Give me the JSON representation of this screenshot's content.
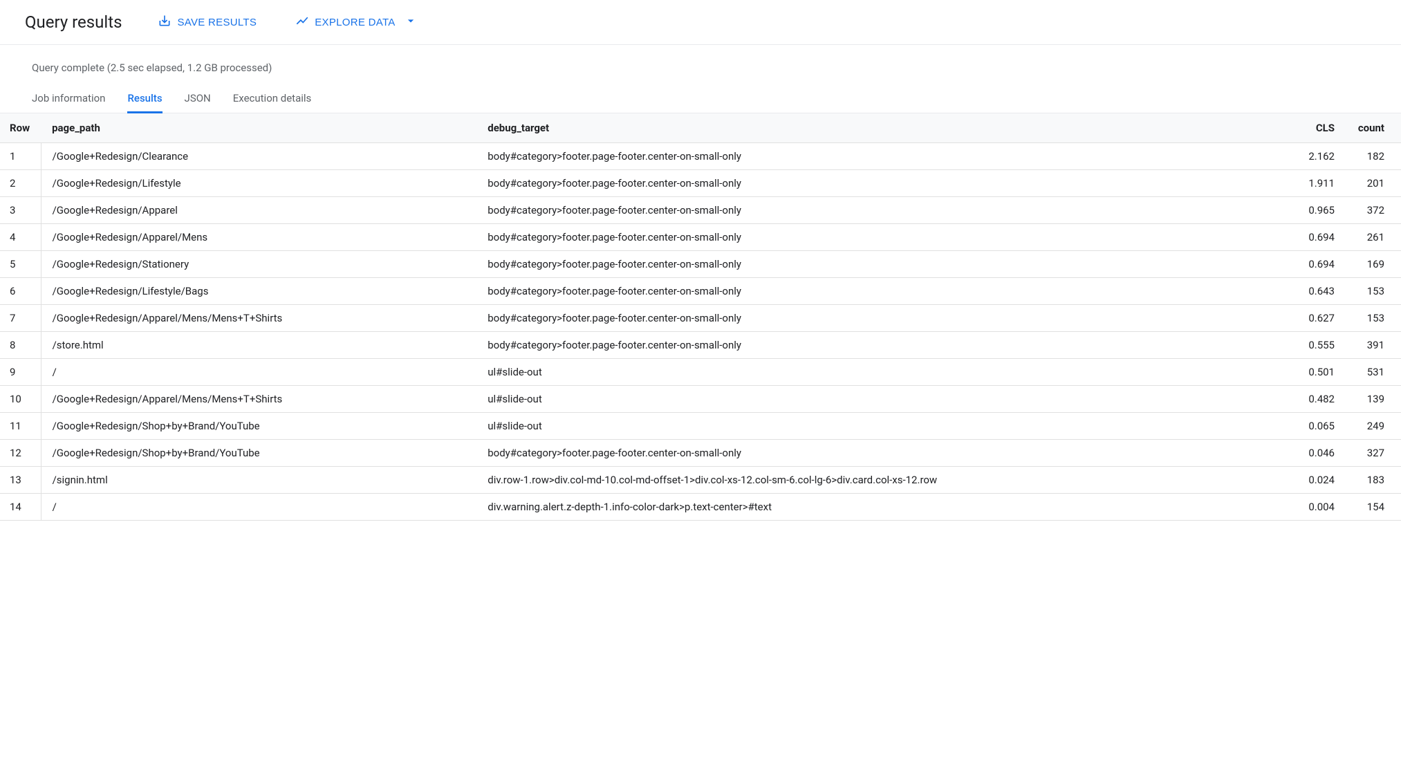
{
  "header": {
    "title": "Query results",
    "save_button": "SAVE RESULTS",
    "explore_button": "EXPLORE DATA"
  },
  "status": {
    "text": "Query complete (2.5 sec elapsed, 1.2 GB processed)"
  },
  "tabs": [
    {
      "label": "Job information",
      "active": false
    },
    {
      "label": "Results",
      "active": true
    },
    {
      "label": "JSON",
      "active": false
    },
    {
      "label": "Execution details",
      "active": false
    }
  ],
  "table": {
    "columns": [
      "Row",
      "page_path",
      "debug_target",
      "CLS",
      "count"
    ],
    "rows": [
      {
        "row": "1",
        "page_path": "/Google+Redesign/Clearance",
        "debug_target": "body#category>footer.page-footer.center-on-small-only",
        "cls": "2.162",
        "count": "182"
      },
      {
        "row": "2",
        "page_path": "/Google+Redesign/Lifestyle",
        "debug_target": "body#category>footer.page-footer.center-on-small-only",
        "cls": "1.911",
        "count": "201"
      },
      {
        "row": "3",
        "page_path": "/Google+Redesign/Apparel",
        "debug_target": "body#category>footer.page-footer.center-on-small-only",
        "cls": "0.965",
        "count": "372"
      },
      {
        "row": "4",
        "page_path": "/Google+Redesign/Apparel/Mens",
        "debug_target": "body#category>footer.page-footer.center-on-small-only",
        "cls": "0.694",
        "count": "261"
      },
      {
        "row": "5",
        "page_path": "/Google+Redesign/Stationery",
        "debug_target": "body#category>footer.page-footer.center-on-small-only",
        "cls": "0.694",
        "count": "169"
      },
      {
        "row": "6",
        "page_path": "/Google+Redesign/Lifestyle/Bags",
        "debug_target": "body#category>footer.page-footer.center-on-small-only",
        "cls": "0.643",
        "count": "153"
      },
      {
        "row": "7",
        "page_path": "/Google+Redesign/Apparel/Mens/Mens+T+Shirts",
        "debug_target": "body#category>footer.page-footer.center-on-small-only",
        "cls": "0.627",
        "count": "153"
      },
      {
        "row": "8",
        "page_path": "/store.html",
        "debug_target": "body#category>footer.page-footer.center-on-small-only",
        "cls": "0.555",
        "count": "391"
      },
      {
        "row": "9",
        "page_path": "/",
        "debug_target": "ul#slide-out",
        "cls": "0.501",
        "count": "531"
      },
      {
        "row": "10",
        "page_path": "/Google+Redesign/Apparel/Mens/Mens+T+Shirts",
        "debug_target": "ul#slide-out",
        "cls": "0.482",
        "count": "139"
      },
      {
        "row": "11",
        "page_path": "/Google+Redesign/Shop+by+Brand/YouTube",
        "debug_target": "ul#slide-out",
        "cls": "0.065",
        "count": "249"
      },
      {
        "row": "12",
        "page_path": "/Google+Redesign/Shop+by+Brand/YouTube",
        "debug_target": "body#category>footer.page-footer.center-on-small-only",
        "cls": "0.046",
        "count": "327"
      },
      {
        "row": "13",
        "page_path": "/signin.html",
        "debug_target": "div.row-1.row>div.col-md-10.col-md-offset-1>div.col-xs-12.col-sm-6.col-lg-6>div.card.col-xs-12.row",
        "cls": "0.024",
        "count": "183"
      },
      {
        "row": "14",
        "page_path": "/",
        "debug_target": "div.warning.alert.z-depth-1.info-color-dark>p.text-center>#text",
        "cls": "0.004",
        "count": "154"
      }
    ]
  }
}
